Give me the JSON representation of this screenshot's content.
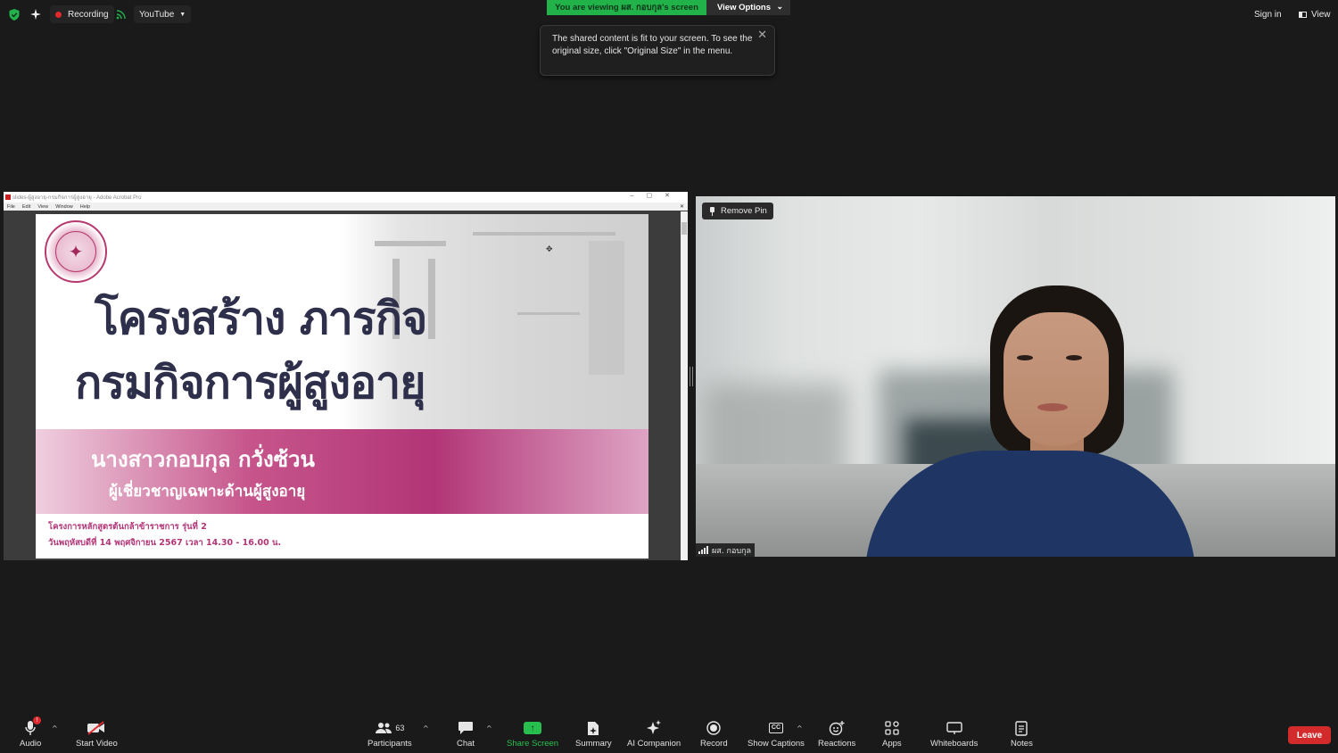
{
  "topbar": {
    "recording_label": "Recording",
    "stream_label": "YouTube",
    "sign_in_label": "Sign in",
    "view_label": "View",
    "viewing_banner": "You are viewing ผส. กอบกุล's screen",
    "view_options_label": "View Options"
  },
  "tooltip": {
    "text": "The shared content is fit to your screen. To see the original size, click \"Original Size\" in the menu."
  },
  "acrobat": {
    "window_title": "slides-ผู้สูงอายุ-กรมกิจการผู้สูงอายุ - Adobe Acrobat Pro",
    "menu": [
      "File",
      "Edit",
      "View",
      "Window",
      "Help"
    ]
  },
  "slide": {
    "title_line1": "โครงสร้าง ภารกิจ",
    "title_line2": "กรมกิจการผู้สูงอายุ",
    "presenter_name": "นางสาวกอบกุล กวั่งซ้วน",
    "presenter_role": "ผู้เชี่ยวชาญเฉพาะด้านผู้สูงอายุ",
    "program": "โครงการหลักสูตรต้นกล้าข้าราชการ รุ่นที่ 2",
    "schedule": "วันพฤหัสบดีที่ 14 พฤศจิกายน 2567 เวลา 14.30 - 16.00 น."
  },
  "video": {
    "remove_pin_label": "Remove Pin",
    "participant_name": "ผส. กอบกุล"
  },
  "toolbar": {
    "audio": "Audio",
    "start_video": "Start Video",
    "participants": "Participants",
    "participants_count": "63",
    "chat": "Chat",
    "share_screen": "Share Screen",
    "summary": "Summary",
    "ai_companion": "AI Companion",
    "record": "Record",
    "show_captions": "Show Captions",
    "reactions": "Reactions",
    "apps": "Apps",
    "whiteboards": "Whiteboards",
    "notes": "Notes",
    "leave": "Leave"
  },
  "colors": {
    "banner_green": "#21b24a",
    "slide_magenta": "#b23577",
    "slide_title": "#2e2f4a",
    "leave_red": "#d32b2b",
    "share_green": "#27c04f"
  }
}
